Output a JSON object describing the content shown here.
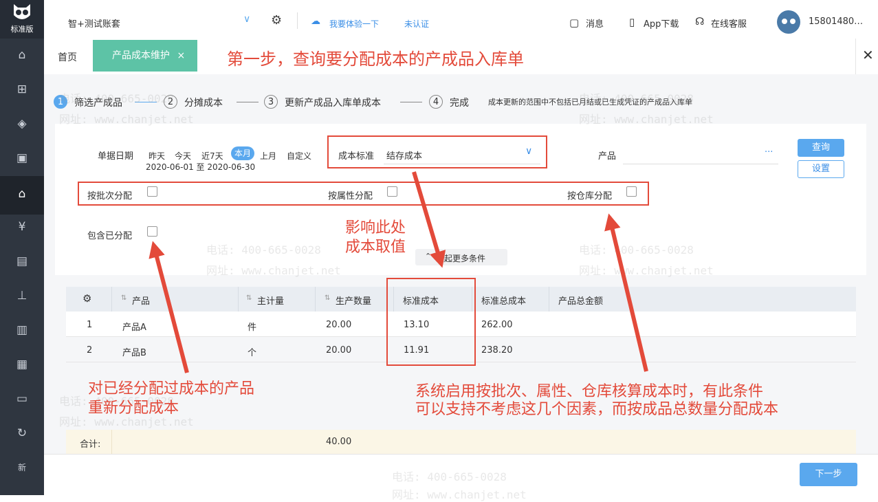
{
  "sidebar": {
    "version": "标准版",
    "icons": [
      "home-icon",
      "gift-icon",
      "tag-icon",
      "bag-icon",
      "warehouse-icon",
      "money-icon",
      "invoice-icon",
      "stamp-icon",
      "building-icon",
      "clipboard-icon",
      "id-card-icon",
      "refresh-icon",
      "new-icon"
    ]
  },
  "header": {
    "account": "智+测试账套",
    "experience": "我要体验一下",
    "verify": "未认证",
    "messages": "消息",
    "app_download": "App下载",
    "online_service": "在线客服",
    "user": "15801480…"
  },
  "tabs": {
    "home": "首页",
    "active": "产品成本维护",
    "close": "×"
  },
  "steps": [
    {
      "num": "1",
      "label": "筛选产成品"
    },
    {
      "num": "2",
      "label": "分摊成本"
    },
    {
      "num": "3",
      "label": "更新产成品入库单成本"
    },
    {
      "num": "4",
      "label": "完成"
    }
  ],
  "steps_note": "成本更新的范围中不包括已月结或已生成凭证的产成品入库单",
  "filter": {
    "date_label": "单据日期",
    "date_options": [
      "昨天",
      "今天",
      "近7天",
      "本月",
      "上月",
      "自定义"
    ],
    "date_range": "2020-06-01 至 2020-06-30",
    "cost_std_label": "成本标准",
    "cost_std_value": "结存成本",
    "product_label": "产品",
    "more": "···",
    "query_btn": "查询",
    "settings_btn": "设置",
    "by_batch": "按批次分配",
    "by_attr": "按属性分配",
    "by_warehouse": "按仓库分配",
    "include_allocated": "包含已分配",
    "collapse": "收起更多条件"
  },
  "table": {
    "headers": [
      "产品",
      "主计量",
      "生产数量",
      "标准成本",
      "标准总成本",
      "产品总金额"
    ],
    "rows": [
      {
        "idx": "1",
        "product": "产品A",
        "unit": "件",
        "qty": "20.00",
        "std_cost": "13.10",
        "std_total": "262.00",
        "amount": ""
      },
      {
        "idx": "2",
        "product": "产品B",
        "unit": "个",
        "qty": "20.00",
        "std_cost": "11.91",
        "std_total": "238.20",
        "amount": ""
      }
    ],
    "total_label": "合计:",
    "total_qty": "40.00"
  },
  "next_btn": "下一步",
  "annotations": {
    "step1": "第一步，查询要分配成本的产成品入库单",
    "affect": [
      "影响此处",
      "成本取值"
    ],
    "realloc": [
      "对已经分配过成本的产品",
      "重新分配成本"
    ],
    "system": [
      "系统启用按批次、属性、仓库核算成本时，有此条件",
      "可以支持不考虑这几个因素，而按成品总数量分配成本"
    ]
  },
  "watermark": {
    "phone": "电话: 400-665-0028",
    "site": "网址: www.chanjet.net"
  },
  "colors": {
    "accent": "#5aa8ee",
    "tab": "#5dc3a6",
    "annotation": "#e34a3a",
    "sidebar": "#2f3640"
  }
}
